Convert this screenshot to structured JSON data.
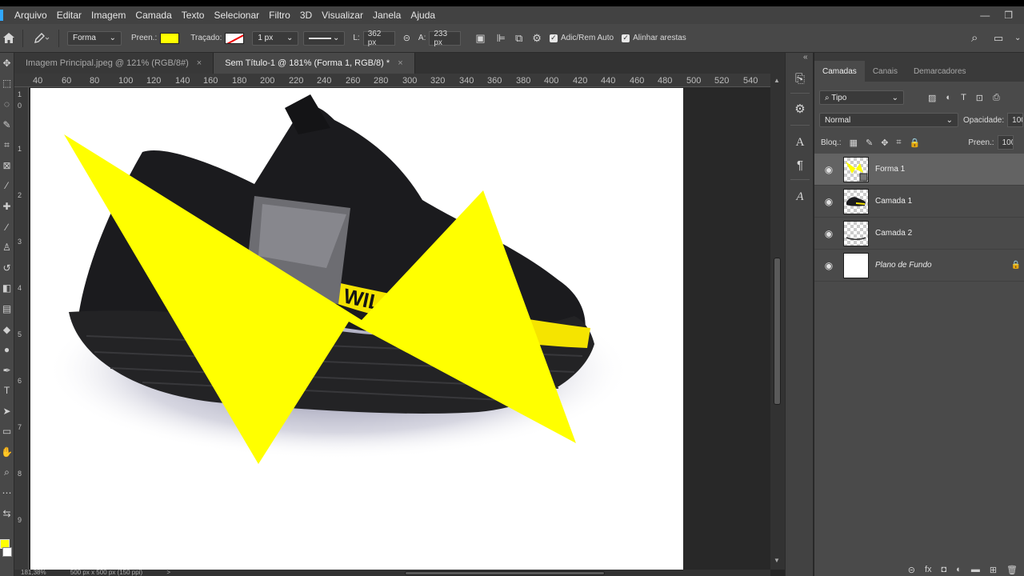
{
  "menubar": {
    "items": [
      "Arquivo",
      "Editar",
      "Imagem",
      "Camada",
      "Texto",
      "Selecionar",
      "Filtro",
      "3D",
      "Visualizar",
      "Janela",
      "Ajuda"
    ],
    "minimize": "—",
    "restore": "❐"
  },
  "options": {
    "home_icon": "home-icon",
    "tool_icon": "pen-icon",
    "mode": "Forma",
    "fill_label": "Preen.:",
    "fill_color": "#ffff00",
    "stroke_label": "Traçado:",
    "stroke_width": "1 px",
    "width_label": "L:",
    "width_value": "362 px",
    "height_label": "A:",
    "height_value": "233 px",
    "auto_add_remove": "Adic/Rem Auto",
    "align_edges": "Alinhar arestas"
  },
  "tabs": [
    {
      "label": "Imagem Principal.jpeg @ 121% (RGB/8#)",
      "close": "×"
    },
    {
      "label": "Sem Título-1 @ 181% (Forma 1, RGB/8) *",
      "close": "×"
    }
  ],
  "ruler": {
    "top_labels": [
      "40",
      "60",
      "80",
      "100",
      "120",
      "140",
      "160",
      "180",
      "200",
      "220",
      "240",
      "260",
      "280",
      "300",
      "320",
      "340",
      "360",
      "380",
      "400",
      "420",
      "440",
      "460",
      "480",
      "500",
      "520",
      "540"
    ],
    "left_labels": [
      "1",
      "0",
      "1",
      "2",
      "3",
      "4",
      "5",
      "6",
      "7",
      "8",
      "9"
    ]
  },
  "status": {
    "zoom": "181,38%",
    "doc_size": "500 px x 500 px (150 ppi)",
    "arrow": ">"
  },
  "panel": {
    "tabs": [
      "Camadas",
      "Canais",
      "Demarcadores"
    ],
    "filter_label": "Tipo",
    "blend_mode": "Normal",
    "opacity_label": "Opacidade:",
    "opacity_value": "100",
    "lock_label": "Bloq.:",
    "fill_label": "Preen.:",
    "fill_value": "100",
    "layers": [
      {
        "name": "Forma 1",
        "selected": true,
        "visible": true
      },
      {
        "name": "Camada 1",
        "selected": false,
        "visible": true
      },
      {
        "name": "Camada 2",
        "selected": false,
        "visible": true
      },
      {
        "name": "Plano de Fundo",
        "selected": false,
        "visible": true,
        "locked": true
      }
    ]
  },
  "colors": {
    "accent": "#31a8ff",
    "foreground": "#ffff00",
    "background": "#ffffff",
    "shape_fill": "#ffff00"
  }
}
